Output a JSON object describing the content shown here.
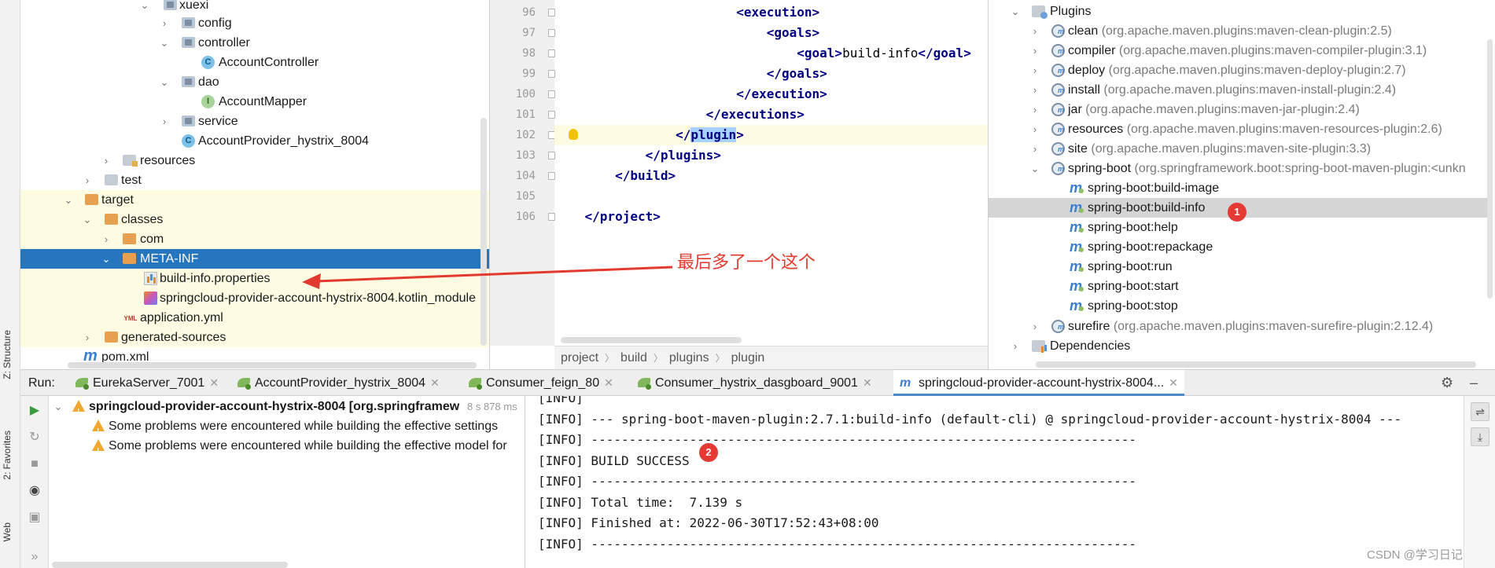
{
  "side_tabs": {
    "structure": "Z: Structure",
    "favorites": "2: Favorites",
    "web": "Web"
  },
  "project_tree": {
    "items": [
      {
        "label": "xuexi",
        "icon": "package-folder-icon"
      },
      {
        "label": "config",
        "icon": "package-folder-icon"
      },
      {
        "label": "controller",
        "icon": "package-folder-icon"
      },
      {
        "label": "AccountController",
        "icon": "class-icon",
        "badge": "C"
      },
      {
        "label": "dao",
        "icon": "package-folder-icon"
      },
      {
        "label": "AccountMapper",
        "icon": "interface-icon",
        "badge": "I"
      },
      {
        "label": "service",
        "icon": "package-folder-icon"
      },
      {
        "label": "AccountProvider_hystrix_8004",
        "icon": "spring-app-class-icon",
        "badge": "C"
      },
      {
        "label": "resources",
        "icon": "resources-folder-icon"
      },
      {
        "label": "test",
        "icon": "folder-icon"
      },
      {
        "label": "target",
        "icon": "excluded-folder-icon"
      },
      {
        "label": "classes",
        "icon": "excluded-folder-icon"
      },
      {
        "label": "com",
        "icon": "excluded-folder-icon"
      },
      {
        "label": "META-INF",
        "icon": "excluded-folder-icon"
      },
      {
        "label": "build-info.properties",
        "icon": "properties-file-icon"
      },
      {
        "label": "springcloud-provider-account-hystrix-8004.kotlin_module",
        "icon": "kotlin-file-icon"
      },
      {
        "label": "application.yml",
        "icon": "yml-file-icon",
        "badge": "YML"
      },
      {
        "label": "generated-sources",
        "icon": "excluded-folder-icon"
      },
      {
        "label": "pom.xml",
        "icon": "maven-file-icon",
        "badge": "m"
      }
    ]
  },
  "editor": {
    "line_numbers": [
      "96",
      "97",
      "98",
      "99",
      "100",
      "101",
      "102",
      "103",
      "104",
      "105",
      "106"
    ],
    "lines": [
      {
        "indent": "                        ",
        "open": "<",
        "tag": "execution",
        "close": ">",
        "text": "",
        "end": ""
      },
      {
        "indent": "                            ",
        "open": "<",
        "tag": "goals",
        "close": ">",
        "text": "",
        "end": ""
      },
      {
        "indent": "                                ",
        "open": "<",
        "tag": "goal",
        "close": ">",
        "text": "build-info",
        "end": "</goal>"
      },
      {
        "indent": "                            ",
        "open": "</",
        "tag": "goals",
        "close": ">",
        "text": "",
        "end": ""
      },
      {
        "indent": "                        ",
        "open": "</",
        "tag": "execution",
        "close": ">",
        "text": "",
        "end": ""
      },
      {
        "indent": "                    ",
        "open": "</",
        "tag": "executions",
        "close": ">",
        "text": "",
        "end": ""
      },
      {
        "indent": "                ",
        "open": "</",
        "tag": "plugin",
        "close": ">",
        "text": "",
        "end": ""
      },
      {
        "indent": "            ",
        "open": "</",
        "tag": "plugins",
        "close": ">",
        "text": "",
        "end": ""
      },
      {
        "indent": "        ",
        "open": "</",
        "tag": "build",
        "close": ">",
        "text": "",
        "end": ""
      },
      {
        "indent": "",
        "open": "",
        "tag": "",
        "close": "",
        "text": "",
        "end": ""
      },
      {
        "indent": "    ",
        "open": "</",
        "tag": "project",
        "close": ">",
        "text": "",
        "end": ""
      }
    ],
    "breadcrumb": [
      "project",
      "build",
      "plugins",
      "plugin"
    ]
  },
  "maven": {
    "plugins_label": "Plugins",
    "plugins": [
      {
        "name": "clean",
        "coord": "(org.apache.maven.plugins:maven-clean-plugin:2.5)"
      },
      {
        "name": "compiler",
        "coord": "(org.apache.maven.plugins:maven-compiler-plugin:3.1)"
      },
      {
        "name": "deploy",
        "coord": "(org.apache.maven.plugins:maven-deploy-plugin:2.7)"
      },
      {
        "name": "install",
        "coord": "(org.apache.maven.plugins:maven-install-plugin:2.4)"
      },
      {
        "name": "jar",
        "coord": "(org.apache.maven.plugins:maven-jar-plugin:2.4)"
      },
      {
        "name": "resources",
        "coord": "(org.apache.maven.plugins:maven-resources-plugin:2.6)"
      },
      {
        "name": "site",
        "coord": "(org.apache.maven.plugins:maven-site-plugin:3.3)"
      },
      {
        "name": "spring-boot",
        "coord": "(org.springframework.boot:spring-boot-maven-plugin:<unkn"
      }
    ],
    "goals": [
      "spring-boot:build-image",
      "spring-boot:build-info",
      "spring-boot:help",
      "spring-boot:repackage",
      "spring-boot:run",
      "spring-boot:start",
      "spring-boot:stop"
    ],
    "surefire": {
      "name": "surefire",
      "coord": "(org.apache.maven.plugins:maven-surefire-plugin:2.12.4)"
    },
    "dependencies_label": "Dependencies"
  },
  "annotation": {
    "text": "最后多了一个这个",
    "badge1": "1",
    "badge2": "2"
  },
  "run_bar": {
    "label": "Run:",
    "tabs": [
      "EurekaServer_7001",
      "AccountProvider_hystrix_8004",
      "Consumer_feign_80",
      "Consumer_hystrix_dasgboard_9001",
      "springcloud-provider-account-hystrix-8004..."
    ]
  },
  "run_tree": {
    "root": "springcloud-provider-account-hystrix-8004 [org.springframew",
    "elapsed": "8 s 878 ms",
    "warnings": [
      "Some problems were encountered while building the effective settings",
      "Some problems were encountered while building the effective model for"
    ]
  },
  "console": {
    "lines": [
      "[INFO]",
      "[INFO] --- spring-boot-maven-plugin:2.7.1:build-info (default-cli) @ springcloud-provider-account-hystrix-8004 ---",
      "[INFO] ------------------------------------------------------------------------",
      "[INFO] BUILD SUCCESS",
      "[INFO] ------------------------------------------------------------------------",
      "[INFO] Total time:  7.139 s",
      "[INFO] Finished at: 2022-06-30T17:52:43+08:00",
      "[INFO] ------------------------------------------------------------------------"
    ]
  },
  "watermark": "CSDN @学习日记",
  "colors": {
    "selection": "#2675bf",
    "excluded_highlight": "#fdfbe1",
    "xml_tag": "#000080",
    "annotation_red": "#e23a2f",
    "badge_red": "#e53935"
  }
}
